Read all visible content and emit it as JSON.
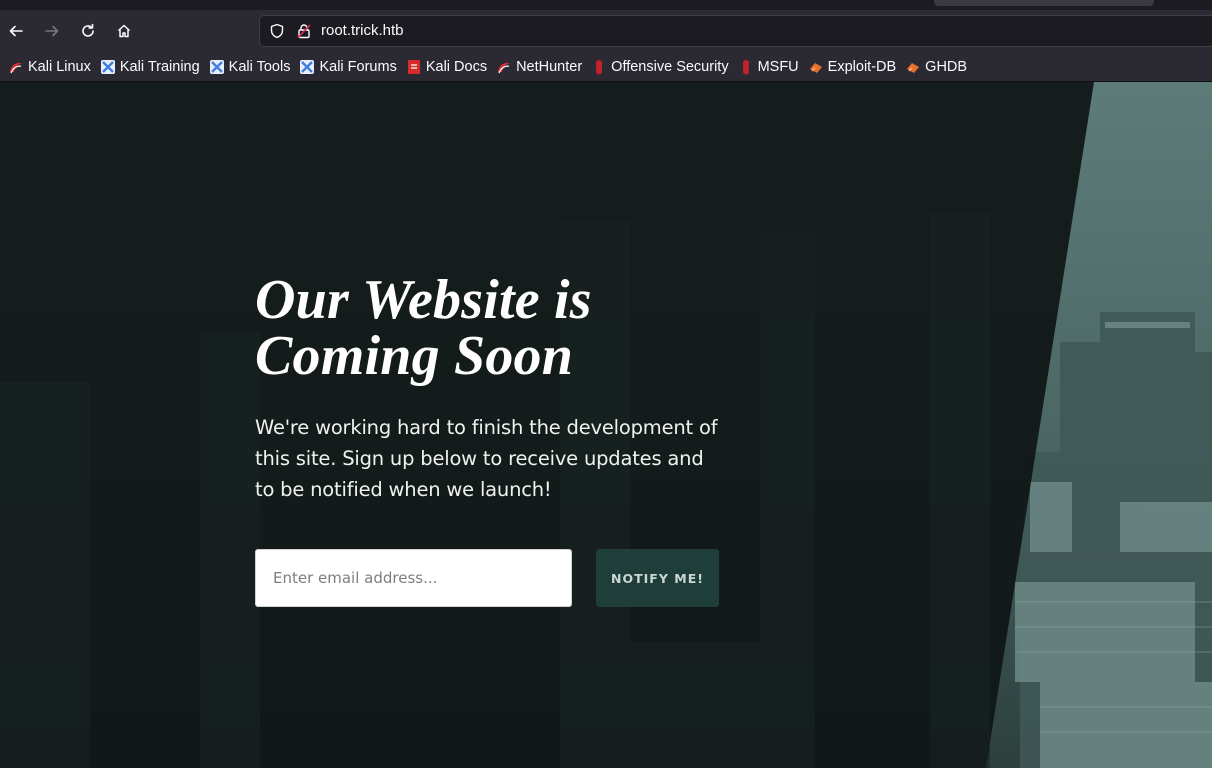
{
  "browser": {
    "url": "root.trick.htb",
    "icons": {
      "back": "arrow-left-icon",
      "forward": "arrow-right-icon",
      "reload": "reload-icon",
      "home": "home-icon",
      "tracking": "shield-icon",
      "insecure": "lock-warning-icon"
    }
  },
  "bookmarks": [
    {
      "label": "Kali Linux",
      "icon": "kali-icon",
      "color": "#e0303a"
    },
    {
      "label": "Kali Training",
      "icon": "kali-training-icon",
      "color": "#3f7fdf"
    },
    {
      "label": "Kali Tools",
      "icon": "kali-tools-icon",
      "color": "#3f7fdf"
    },
    {
      "label": "Kali Forums",
      "icon": "kali-forums-icon",
      "color": "#3f7fdf"
    },
    {
      "label": "Kali Docs",
      "icon": "kali-docs-icon",
      "color": "#d62b2b"
    },
    {
      "label": "NetHunter",
      "icon": "nethunter-icon",
      "color": "#e0303a"
    },
    {
      "label": "Offensive Security",
      "icon": "offsec-icon",
      "color": "#c2222b"
    },
    {
      "label": "MSFU",
      "icon": "msfu-icon",
      "color": "#c2222b"
    },
    {
      "label": "Exploit-DB",
      "icon": "exploitdb-icon",
      "color": "#e8712b"
    },
    {
      "label": "GHDB",
      "icon": "ghdb-icon",
      "color": "#e8712b"
    }
  ],
  "hero": {
    "title_line1": "Our Website is",
    "title_line2": "Coming Soon",
    "description": "We're working hard to finish the development of this site. Sign up below to receive updates and to be notified when we launch!"
  },
  "signup": {
    "placeholder": "Enter email address...",
    "button_label": "NOTIFY ME!"
  },
  "colors": {
    "button_bg": "#1f3d39",
    "page_bg": "#0d1413",
    "city_tint": "#5f7f7c"
  }
}
